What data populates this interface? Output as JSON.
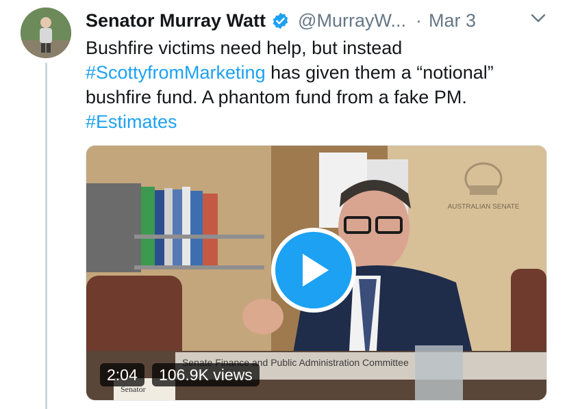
{
  "author": {
    "display_name": "Senator Murray Watt",
    "handle": "@MurrayW...",
    "separator": "·",
    "date": "Mar 3",
    "verified": true
  },
  "tweet": {
    "line1": "Bushfire victims need help, but instead",
    "hashtag1": "#ScottyfromMarketing",
    "line2_rest": " has given them a “notional”",
    "line3": "bushfire fund. A phantom fund from a fake PM.",
    "hashtag2": "#Estimates"
  },
  "video": {
    "duration": "2:04",
    "views": "106.9K views",
    "overlay_caption": "Senate Finance and Public Administration Committee",
    "desk_sign": "Senator",
    "wall_emblem_text": "AUSTRALIAN SENATE"
  },
  "colors": {
    "link": "#1da1f2",
    "muted": "#657786",
    "text": "#14171a",
    "play_button": "#1da1f2"
  },
  "icons": {
    "verified": "verified-badge-icon",
    "menu": "chevron-down-icon",
    "play": "play-icon"
  }
}
